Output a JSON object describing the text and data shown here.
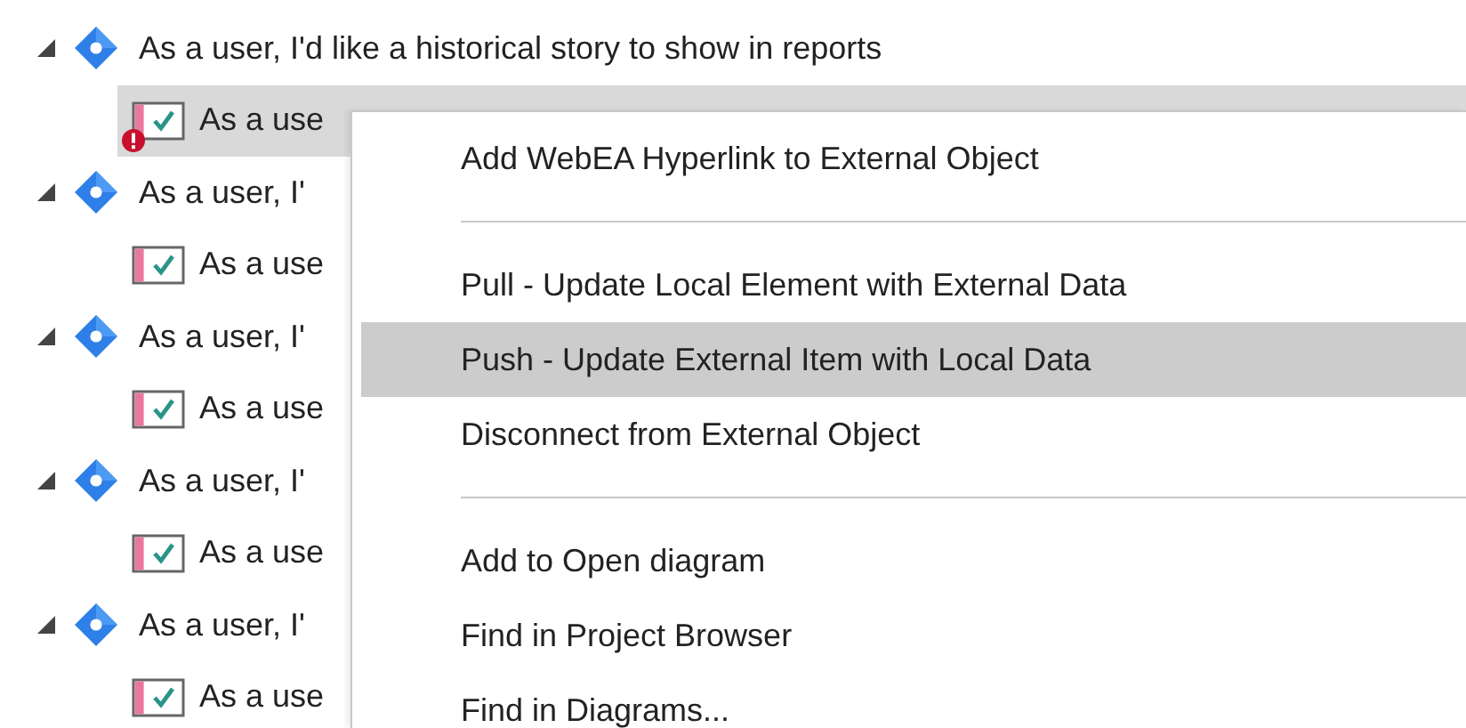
{
  "tree": [
    {
      "label": "As a user, I'd like a historical story to show in reports",
      "expanded": true,
      "children": [
        {
          "label": "As a use",
          "selected": true,
          "error": true
        }
      ]
    },
    {
      "label": "As a user, I'",
      "expanded": true,
      "children": [
        {
          "label": "As a use",
          "selected": false,
          "error": false
        }
      ]
    },
    {
      "label": "As a user, I'",
      "expanded": true,
      "children": [
        {
          "label": "As a use",
          "selected": false,
          "error": false
        }
      ]
    },
    {
      "label": "As a user, I'",
      "expanded": true,
      "children": [
        {
          "label": "As a use",
          "selected": false,
          "error": false
        }
      ]
    },
    {
      "label": "As a user, I'",
      "expanded": true,
      "children": [
        {
          "label": "As a use",
          "selected": false,
          "error": false
        }
      ]
    }
  ],
  "context_menu": {
    "items": [
      {
        "kind": "item",
        "label": "Add WebEA Hyperlink to External Object",
        "selected": false
      },
      {
        "kind": "separator"
      },
      {
        "kind": "item",
        "label": "Pull - Update Local Element with External Data",
        "selected": false
      },
      {
        "kind": "item",
        "label": "Push - Update External Item with Local Data",
        "selected": true
      },
      {
        "kind": "item",
        "label": "Disconnect from External Object",
        "selected": false
      },
      {
        "kind": "separator"
      },
      {
        "kind": "item",
        "label": "Add to Open diagram",
        "selected": false
      },
      {
        "kind": "item",
        "label": "Find in Project Browser",
        "selected": false
      },
      {
        "kind": "item",
        "label": "Find in Diagrams...",
        "selected": false
      }
    ]
  }
}
